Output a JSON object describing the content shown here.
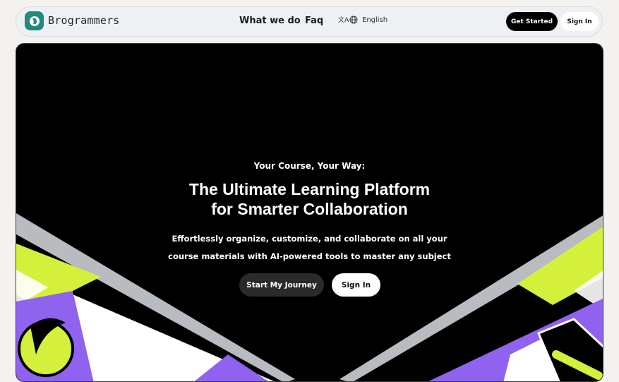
{
  "header": {
    "brand": "Brogrammers",
    "nav": [
      "What we do",
      "Faq"
    ],
    "language": "English",
    "get_started": "Get Started",
    "sign_in": "Sign In"
  },
  "hero": {
    "eyebrow": "Your Course, Your Way:",
    "headline_line1": "The Ultimate Learning Platform",
    "headline_line2": "for Smarter Collaboration",
    "subhead_line1": "Effortlessly organize, customize, and collaborate on all your",
    "subhead_line2": "course materials with AI-powered tools to master any subject",
    "primary_cta": "Start My Journey",
    "secondary_cta": "Sign In"
  },
  "colors": {
    "accent_lime": "#d4f03c",
    "accent_purple": "#8f62f0",
    "brand_teal": "#1f8a7d"
  }
}
